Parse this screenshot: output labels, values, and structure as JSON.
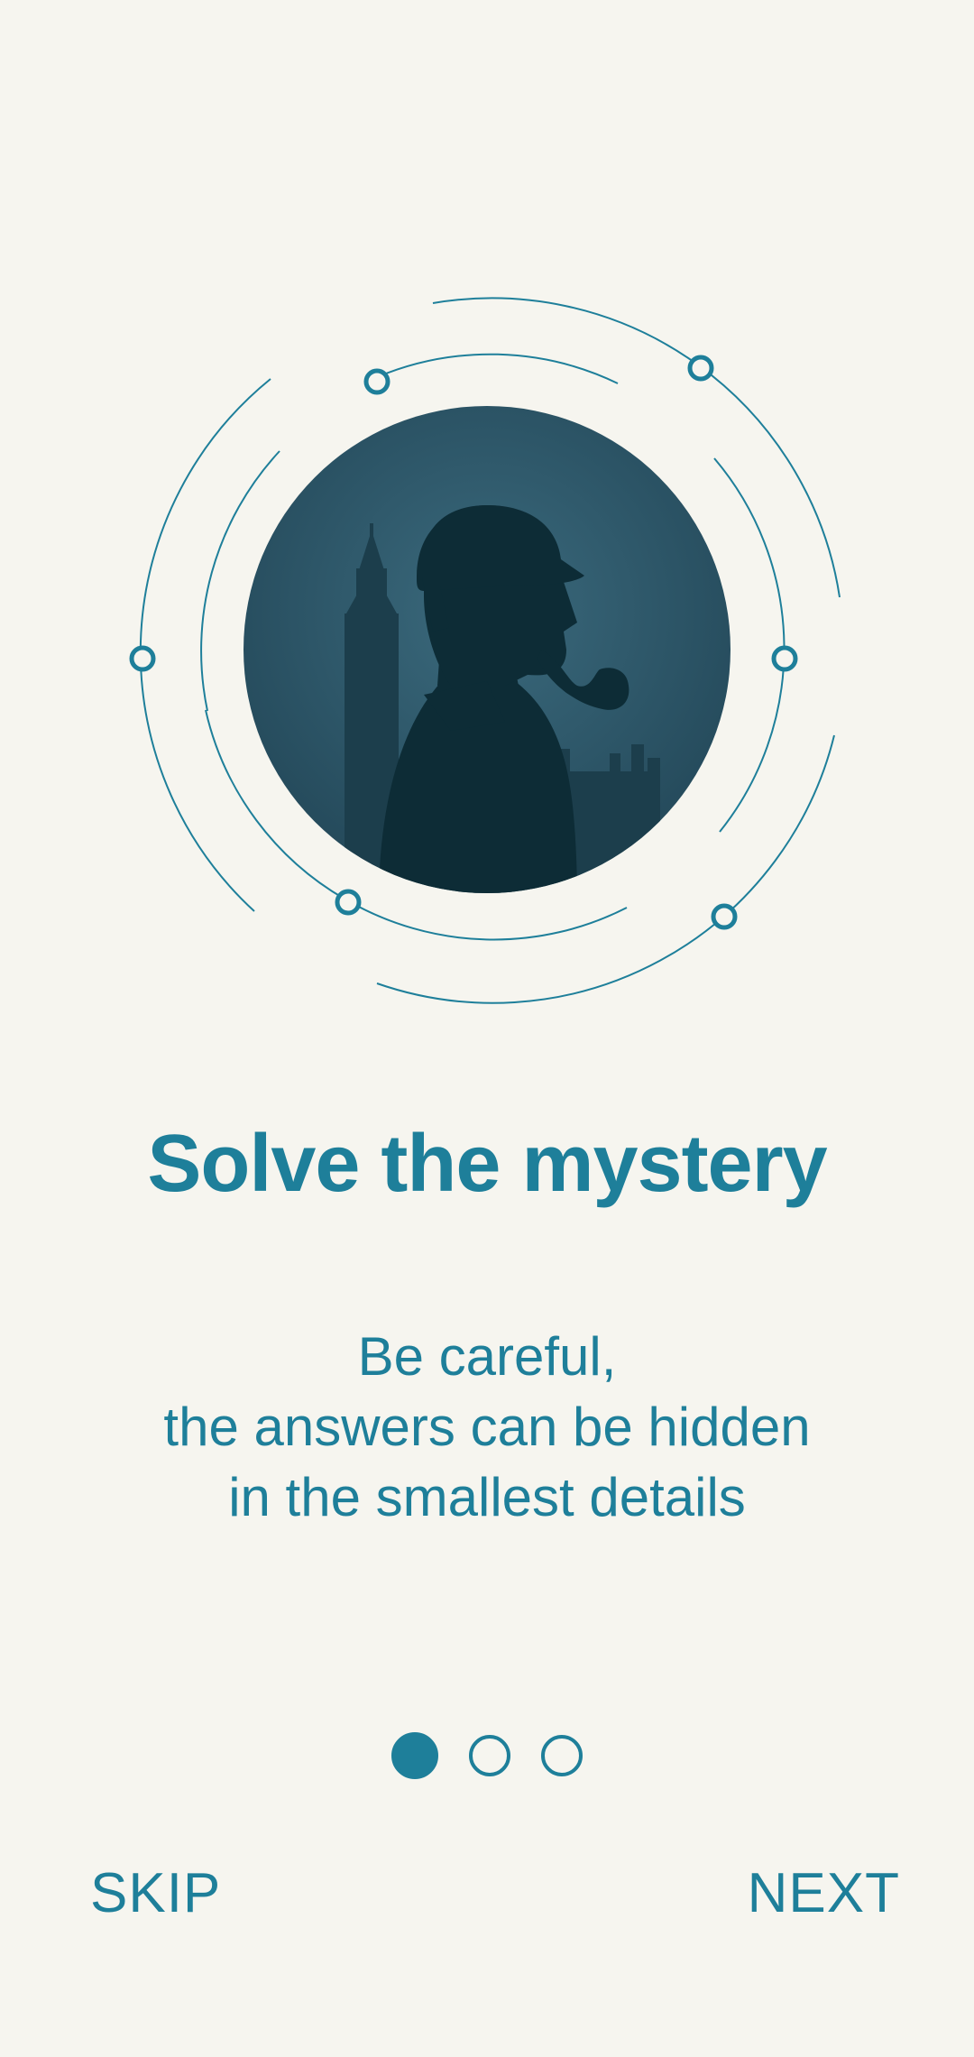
{
  "onboarding": {
    "title": "Solve the mystery",
    "subtitle_lines": [
      "Be careful,",
      "the answers can be hidden",
      "in the smallest details"
    ],
    "pager": {
      "total_pages": 3,
      "current_page": 1
    },
    "skip_label": "SKIP",
    "next_label": "NEXT"
  },
  "theme": {
    "accent": "#1e7f9a",
    "background": "#f6f5ef",
    "illustration_bg": "#2f5a6c",
    "silhouette": "#0d2c36"
  }
}
